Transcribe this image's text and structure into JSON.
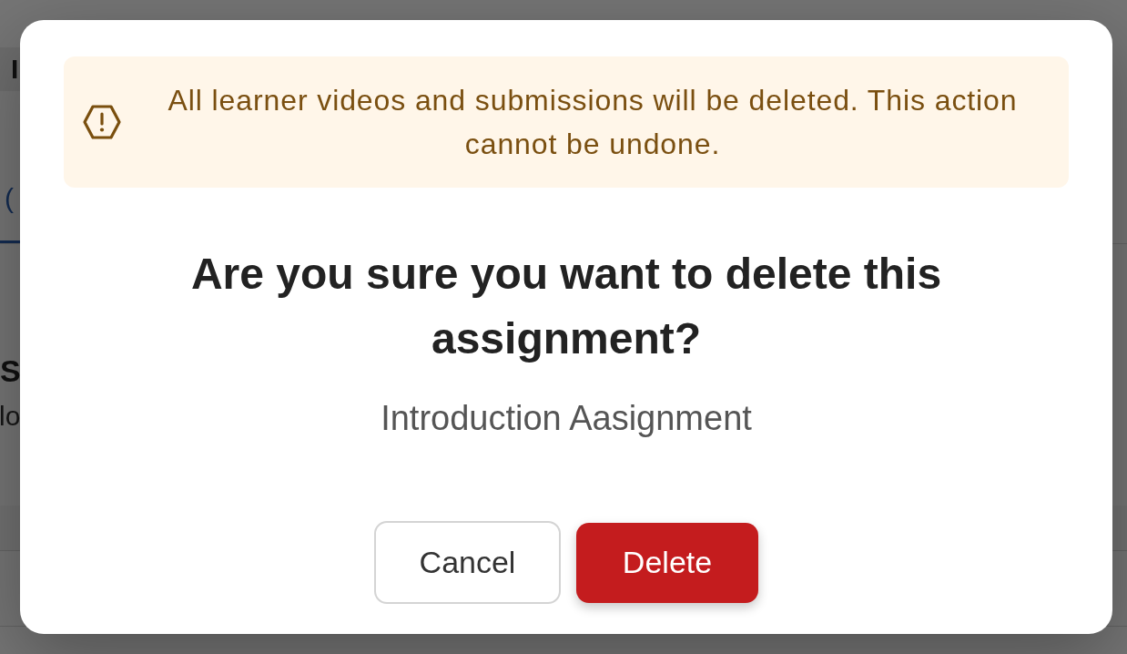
{
  "page": {
    "breadcrumb": "I",
    "tab": {
      "label": "(",
      "selected": true
    },
    "heading": "S",
    "description": "lo"
  },
  "dialog": {
    "warning": "All learner videos and submissions will be deleted. This action cannot be undone.",
    "title": "Are you sure you want to delete this assignment?",
    "subtitle": "Introduction Aasignment",
    "buttons": [
      {
        "label": "Cancel",
        "kind": "secondary"
      },
      {
        "label": "Delete",
        "kind": "danger"
      }
    ]
  }
}
